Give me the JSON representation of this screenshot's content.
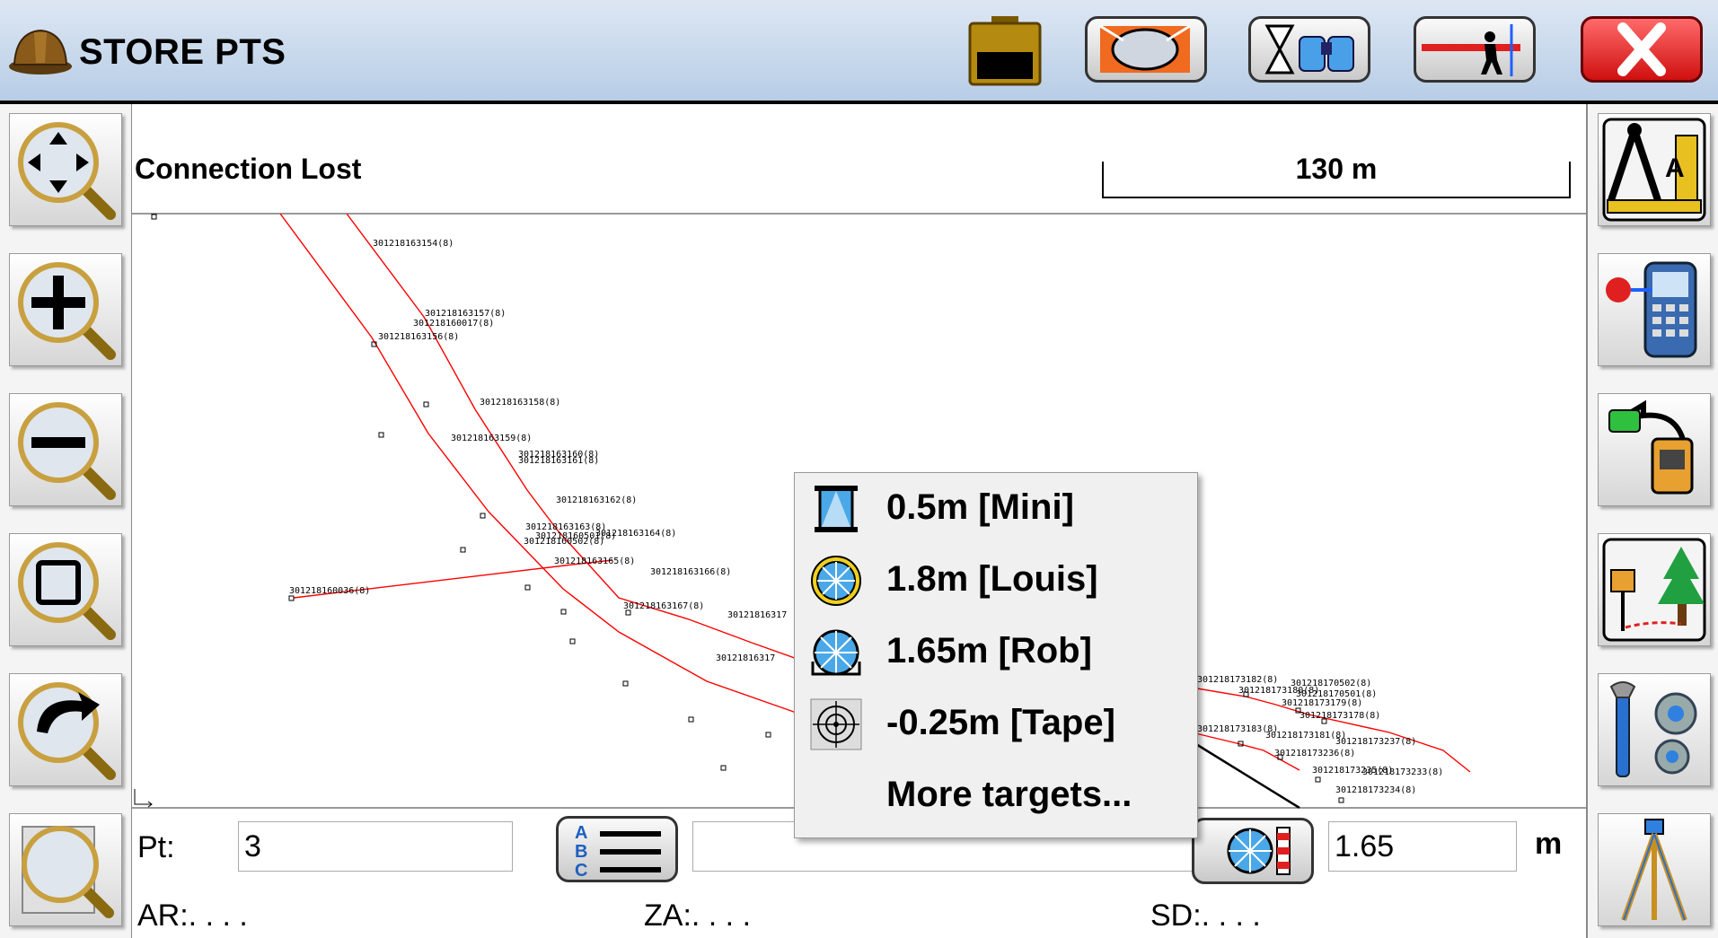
{
  "app": {
    "title": "STORE PTS"
  },
  "status": {
    "connection": "Connection Lost",
    "scale": "130 m"
  },
  "map": {
    "point_labels": [
      {
        "text": "301218163154(8)"
      },
      {
        "text": "301218163157(8)"
      },
      {
        "text": "301218160017(8)"
      },
      {
        "text": "301218163156(8)"
      },
      {
        "text": "301218163158(8)"
      },
      {
        "text": "301218163159(8)"
      },
      {
        "text": "301218163160(8)"
      },
      {
        "text": "301218163161(8)"
      },
      {
        "text": "301218163162(8)"
      },
      {
        "text": "301218163163(8)"
      },
      {
        "text": "301218163164(8)"
      },
      {
        "text": "301218160502(8)"
      },
      {
        "text": "301218160501(8)"
      },
      {
        "text": "301218163165(8)"
      },
      {
        "text": "301218163166(8)"
      },
      {
        "text": "301218160036(8)"
      },
      {
        "text": "301218163167(8)"
      },
      {
        "text": "30121816317"
      },
      {
        "text": "30121816317"
      },
      {
        "text": "301218173182(8)"
      },
      {
        "text": "301218170502(8)"
      },
      {
        "text": "301218170501(8)"
      },
      {
        "text": "301218173180(8)"
      },
      {
        "text": "301218173179(8)"
      },
      {
        "text": "301218173178(8)"
      },
      {
        "text": "301218173183(8)"
      },
      {
        "text": "301218173181(8)"
      },
      {
        "text": "301218173237(8)"
      },
      {
        "text": "301218173236(8)"
      },
      {
        "text": "301218173235(8)"
      },
      {
        "text": "301218173233(8)"
      },
      {
        "text": "301218173234(8)"
      }
    ]
  },
  "popup": {
    "items": [
      {
        "label": "0.5m [Mini]",
        "icon": "mini-prism-icon"
      },
      {
        "label": "1.8m [Louis]",
        "icon": "prism-yellow-icon"
      },
      {
        "label": "1.65m [Rob]",
        "icon": "prism-blue-icon"
      },
      {
        "label": "-0.25m [Tape]",
        "icon": "tape-target-icon"
      },
      {
        "label": "More targets...",
        "icon": ""
      }
    ]
  },
  "bottom": {
    "pt_label": "Pt:",
    "pt_value": "3",
    "description_value": "",
    "height_value": "1.65",
    "height_unit": "m",
    "ar_label": "AR:. . . .",
    "za_label": "ZA:. . . .",
    "sd_label": "SD:. . . ."
  },
  "colors": {
    "line": "#ff0000",
    "accent_red": "#e02020",
    "accent_blue": "#1e90ff"
  }
}
